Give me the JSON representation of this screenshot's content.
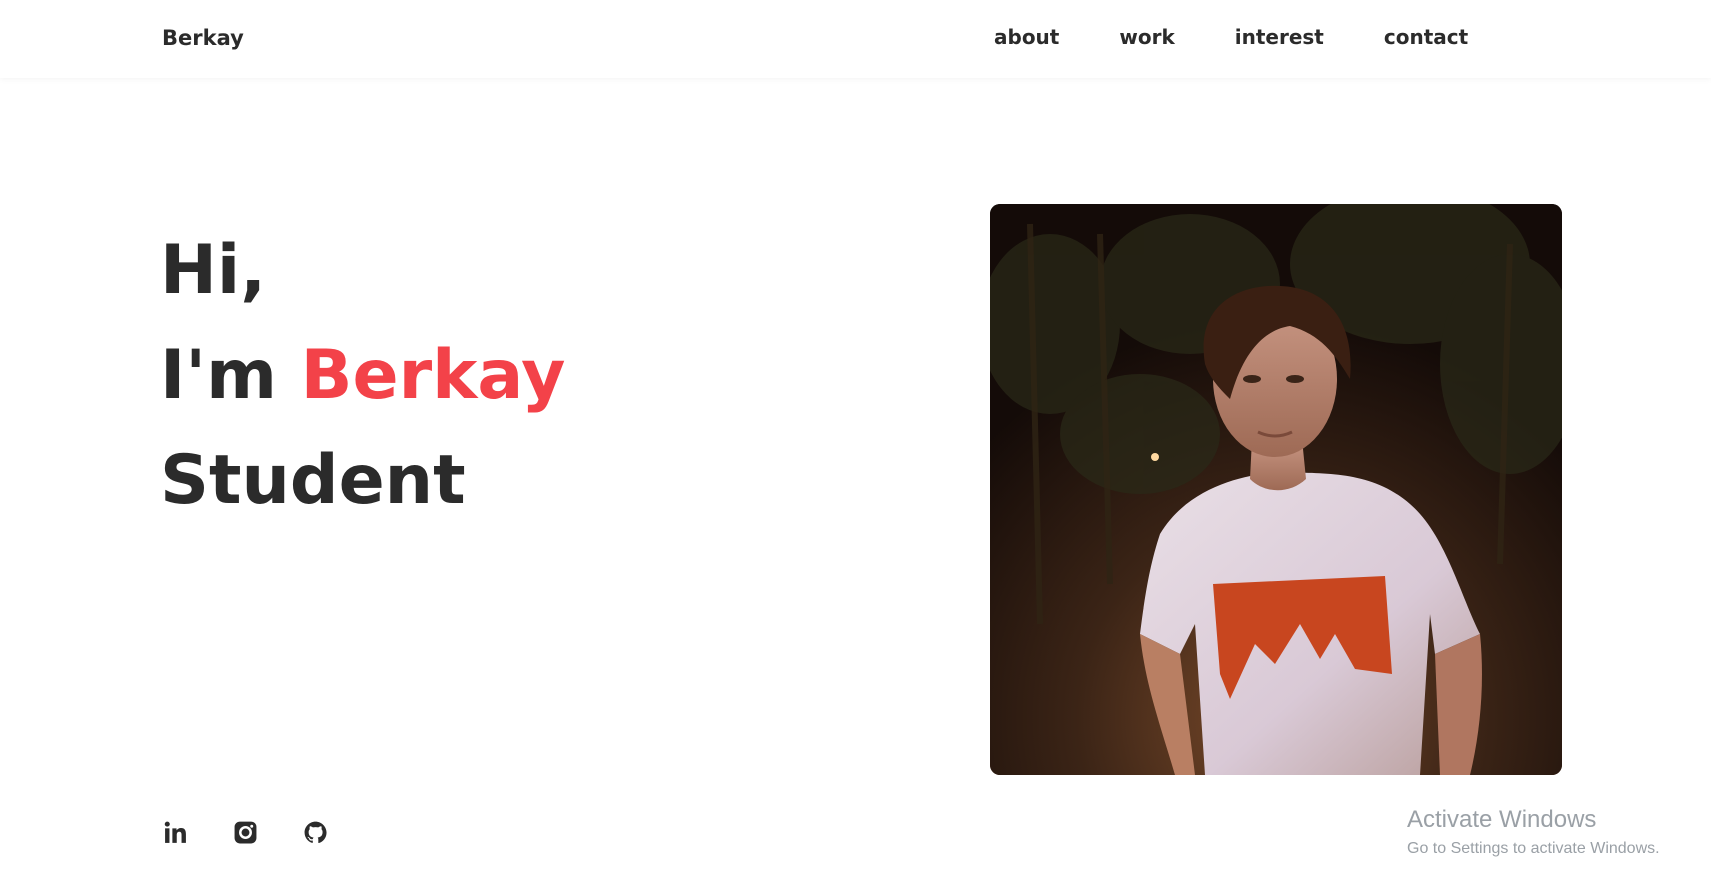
{
  "header": {
    "brand": "Berkay",
    "nav": [
      {
        "label": "about"
      },
      {
        "label": "work"
      },
      {
        "label": "interest"
      },
      {
        "label": "contact"
      }
    ]
  },
  "hero": {
    "greeting": "Hi,",
    "intro_prefix": "I'm ",
    "name": "Berkay",
    "role": "Student",
    "accent_color": "#f34249"
  },
  "photo": {
    "alt": "Portrait photo of Berkay at night wearing a white t-shirt"
  },
  "social": [
    {
      "icon": "linkedin-icon"
    },
    {
      "icon": "instagram-icon"
    },
    {
      "icon": "github-icon"
    }
  ],
  "watermark": {
    "title": "Activate Windows",
    "subtitle": "Go to Settings to activate Windows."
  }
}
